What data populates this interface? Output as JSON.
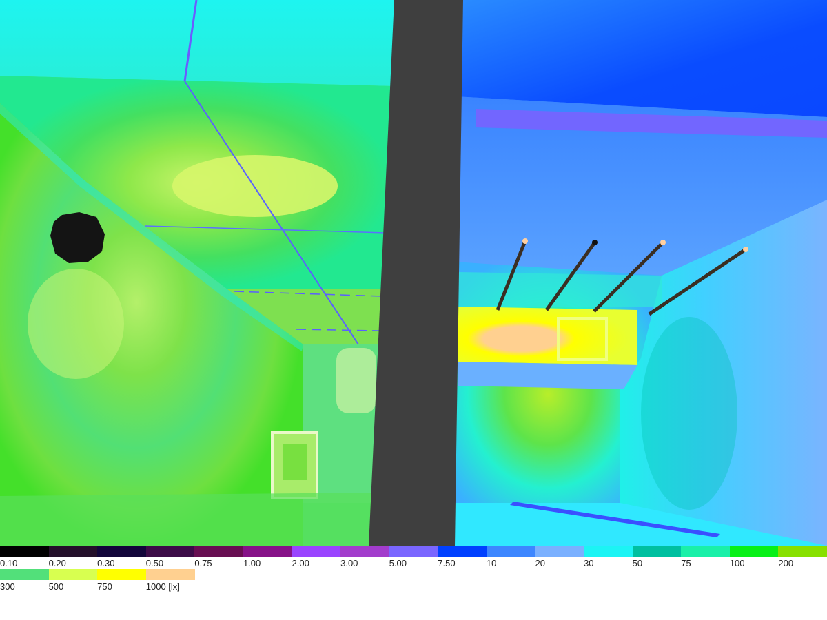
{
  "legend": {
    "row1": [
      {
        "label": "0.10",
        "color": "#000000"
      },
      {
        "label": "0.20",
        "color": "#24102a"
      },
      {
        "label": "0.30",
        "color": "#12063a"
      },
      {
        "label": "0.50",
        "color": "#3c0c48"
      },
      {
        "label": "0.75",
        "color": "#680e52"
      },
      {
        "label": "1.00",
        "color": "#861288"
      },
      {
        "label": "2.00",
        "color": "#9a44ff"
      },
      {
        "label": "3.00",
        "color": "#a23ccc"
      },
      {
        "label": "5.00",
        "color": "#7a66ff"
      },
      {
        "label": "7.50",
        "color": "#0040ff"
      },
      {
        "label": "10",
        "color": "#3d86ff"
      },
      {
        "label": "20",
        "color": "#7ab0ff"
      },
      {
        "label": "30",
        "color": "#1cf4f4"
      },
      {
        "label": "50",
        "color": "#00c0a0"
      },
      {
        "label": "75",
        "color": "#1af0a8"
      },
      {
        "label": "100",
        "color": "#08f018"
      },
      {
        "label": "200",
        "color": "#88e000"
      }
    ],
    "row2": [
      {
        "label": "300",
        "color": "#52e07a"
      },
      {
        "label": "500",
        "color": "#d8ff50"
      },
      {
        "label": "750",
        "color": "#ffff00"
      },
      {
        "label": "1000 [lx]",
        "color": "#ffd090"
      }
    ]
  }
}
